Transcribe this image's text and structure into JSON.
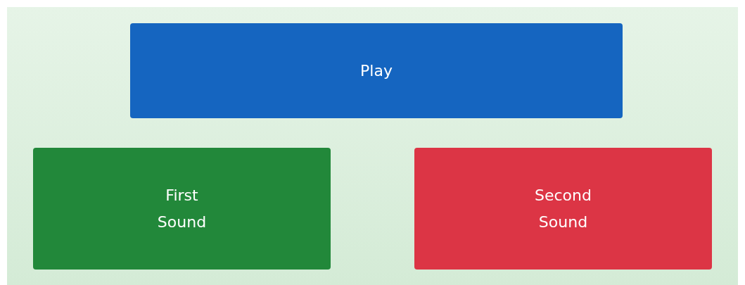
{
  "play_button": {
    "label": "Play"
  },
  "sound_buttons": [
    {
      "label": "First Sound",
      "color": "#22883a"
    },
    {
      "label": "Second Sound",
      "color": "#dc3545"
    }
  ]
}
